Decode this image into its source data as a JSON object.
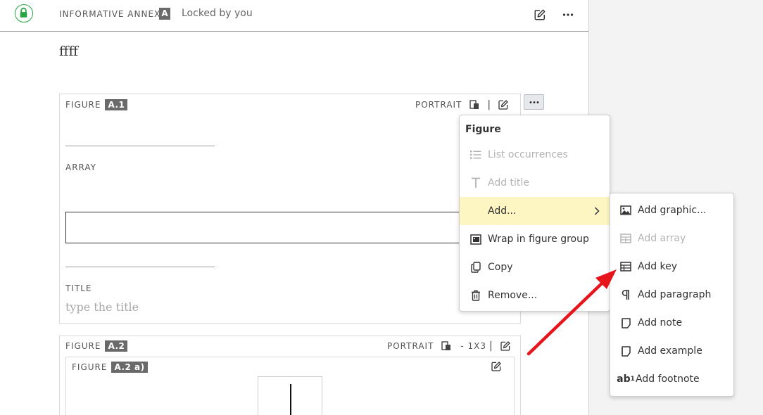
{
  "header": {
    "section_label": "INFORMATIVE ANNEX",
    "section_badge": "A",
    "lock_status": "Locked by you"
  },
  "content": {
    "heading_text": "ffff"
  },
  "figure1": {
    "label": "FIGURE",
    "number": "A.1",
    "orientation": "PORTRAIT",
    "separator": "|",
    "array_label": "ARRAY",
    "title_label": "TITLE",
    "title_placeholder": "type the title"
  },
  "figure2": {
    "label": "FIGURE",
    "number": "A.2",
    "orientation": "PORTRAIT",
    "size": "- 1X3",
    "separator": "|",
    "sub_label": "FIGURE",
    "sub_number": "A.2 a)"
  },
  "context_menu": {
    "title": "Figure",
    "items": [
      {
        "label": "List occurrences",
        "icon": "list-icon",
        "enabled": false
      },
      {
        "label": "Add title",
        "icon": "text-icon",
        "enabled": false
      },
      {
        "label": "Add...",
        "icon": "",
        "enabled": true,
        "highlighted": true
      },
      {
        "label": "Wrap in figure group",
        "icon": "figure-group-icon",
        "enabled": true
      },
      {
        "label": "Copy",
        "icon": "copy-icon",
        "enabled": true
      },
      {
        "label": "Remove...",
        "icon": "trash-icon",
        "enabled": true
      }
    ]
  },
  "submenu": {
    "items": [
      {
        "label": "Add graphic...",
        "icon": "image-icon",
        "enabled": true
      },
      {
        "label": "Add array",
        "icon": "table-icon",
        "enabled": false
      },
      {
        "label": "Add key",
        "icon": "table-icon",
        "enabled": true
      },
      {
        "label": "Add paragraph",
        "icon": "pilcrow-icon",
        "enabled": true
      },
      {
        "label": "Add note",
        "icon": "note-icon",
        "enabled": true
      },
      {
        "label": "Add example",
        "icon": "example-icon",
        "enabled": true
      },
      {
        "label": "Add footnote",
        "icon": "footnote-icon",
        "enabled": true
      }
    ]
  },
  "colors": {
    "lock_green": "#27a545",
    "highlight": "#fdf6c3",
    "annotation_arrow": "#e8141b",
    "badge_gray": "#6a6a6a"
  }
}
